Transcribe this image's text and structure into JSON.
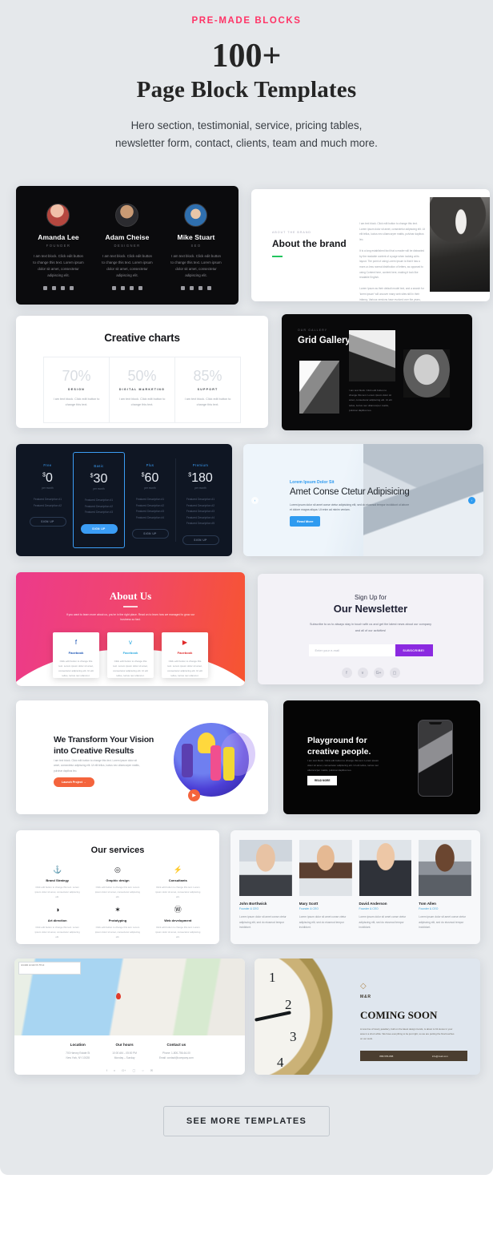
{
  "header": {
    "eyebrow": "PRE-MADE BLOCKS",
    "title": "100+",
    "subtitle": "Page Block Templates",
    "desc_line1": "Hero section, testimonial, service, pricing tables,",
    "desc_line2": "newsletter form, contact, clients, team and much more."
  },
  "cta": {
    "label": "SEE MORE TEMPLATES"
  },
  "colors": {
    "page_bg": "#e5e8eb",
    "accent_pink": "#ff3366",
    "blue": "#3b9df5",
    "purple": "#8b2ae0",
    "orange": "#f4643c",
    "green": "#22c55e"
  },
  "cards": {
    "team_dark": {
      "members": [
        {
          "name": "Amanda Lee",
          "role": "FOUNDER",
          "text": "I am text block. Click edit button to change this text. Lorem ipsum dolor sit amet, consectetur adipiscing elit."
        },
        {
          "name": "Adam Cheise",
          "role": "DESIGNER",
          "text": "I am text block. Click edit button to change this text. Lorem ipsum dolor sit amet, consectetur adipiscing elit."
        },
        {
          "name": "Mike Stuart",
          "role": "SEO",
          "text": "I am text block. Click edit button to change this text. Lorem ipsum dolor sit amet, consectetur adipiscing elit."
        }
      ]
    },
    "about_brand": {
      "kicker": "About the brand",
      "title": "About the brand",
      "paragraphs": [
        "I am text block. Click edit button to change this text. Lorem ipsum dolor sit amet, consectetur adipiscing elit. Ut elit tellus, luctus nec ullamcorper mattis, pulvinar dapibus leo.",
        "It is a long established fact that a reader will be distracted by the readable content of a page when looking at its layout. The point of using Lorem Ipsum is that it has a more-or-less normal distribution of letters, as opposed to using Content here, content here, making it look like readable English.",
        "Lorem Ipsum as their default model text, and a search for 'lorem ipsum' will uncover many web sites still in their infancy. Various versions have evolved over the years, sometimes by accident."
      ]
    },
    "creative_charts": {
      "title": "Creative charts",
      "items": [
        {
          "percent": "70%",
          "label": "DESIGN",
          "text": "I am text block. Click edit button to change this text."
        },
        {
          "percent": "50%",
          "label": "DIGITAL MARKETING",
          "text": "I am text block. Click edit button to change this text."
        },
        {
          "percent": "85%",
          "label": "SUPPORT",
          "text": "I am text block. Click edit button to change this text."
        }
      ]
    },
    "grid_gallery": {
      "kicker": "OUR GALLERY",
      "title": "Grid Gallery Slide",
      "text": "I am text block. Click edit button to change this text. Lorem ipsum dolor sit amet, consectetur adipiscing elit. Ut elit tellus, luctus nec ullamcorper mattis, pulvinar dapibus leo."
    },
    "pricing": {
      "plans": [
        {
          "name": "Free",
          "currency": "$",
          "amount": "0",
          "period": "per month",
          "features": [
            "Featured Description #1",
            "Featured Description #2"
          ],
          "button": "SIGN UP",
          "highlight": false
        },
        {
          "name": "Basic",
          "currency": "$",
          "amount": "30",
          "period": "per month",
          "features": [
            "Featured Description #1",
            "Featured Description #2",
            "Featured Description #3"
          ],
          "button": "SIGN UP",
          "highlight": true
        },
        {
          "name": "Plus",
          "currency": "$",
          "amount": "60",
          "period": "per month",
          "features": [
            "Featured Description #1",
            "Featured Description #2",
            "Featured Description #3",
            "Featured Description #4"
          ],
          "button": "SIGN UP",
          "highlight": false
        },
        {
          "name": "Premium",
          "currency": "$",
          "amount": "180",
          "period": "per month",
          "features": [
            "Featured Description #1",
            "Featured Description #2",
            "Featured Description #3",
            "Featured Description #4",
            "Featured Description #5"
          ],
          "button": "SIGN UP",
          "highlight": false
        }
      ]
    },
    "slider": {
      "kicker": "Lorem Ipsum Dolor Sit",
      "title": "Amet Conse Ctetur Adipisicing",
      "text": "Lorem ipsum dolor sit amet conse ctetur adipisicing elit, sed do eiusmod tempor incididunt ut labore et dolore magna aliqua. Ut enim ad minim veniam.",
      "button": "Read More",
      "prev": "‹",
      "next": "›"
    },
    "about_us": {
      "title": "About Us",
      "text": "If you want to learn more about us, you're in the right place. Read on to learn how we managed to grow our business so fast.",
      "items": [
        {
          "icon": "facebook-icon",
          "glyph": "f",
          "color": "#1b55b5",
          "name": "Facebook",
          "text": "Click edit button to change this text. Lorem ipsum dolor sit amet, consectetur adipiscing elit. Ut elit tellus, luctus nec ullamcor."
        },
        {
          "icon": "twitter-icon",
          "glyph": "ᴠ",
          "color": "#2aa9e0",
          "name": "Facebook",
          "text": "Click edit button to change this text. Lorem ipsum dolor sit amet, consectetur adipiscing elit. Ut elit tellus, luctus nec ullamcor."
        },
        {
          "icon": "youtube-icon",
          "glyph": "▶",
          "color": "#e02a2a",
          "name": "Facebook",
          "text": "Click edit button to change this text. Lorem ipsum dolor sit amet, consectetur adipiscing elit. Ut elit tellus, luctus nec ullamcor."
        }
      ]
    },
    "newsletter": {
      "kicker": "Sign Up for",
      "title": "Our Newsletter",
      "text": "Subscribe to us to always stay in touch with us and get the latest news about our company and all of our activities!",
      "placeholder": "Enter your e-mail",
      "button": "SUBSCRIBE!",
      "socials": [
        "f",
        "ᴠ",
        "G+",
        "▢"
      ]
    },
    "transform": {
      "title": "We Transform Your Vision into Creative Results",
      "text": "I am text block. Click edit button to change this text. Lorem ipsum dolor sit amet, consectetur adipiscing elit. Ut elit tellus, luctus nec ullamcorper mattis, pulvinar dapibus leo.",
      "button": "Launch Project →",
      "play": "▶"
    },
    "playground": {
      "title": "Playground for creative people.",
      "text": "I am text block. Click edit button to change this text. Lorem ipsum dolor sit amet, consectetur adipiscing elit. Ut elit tellus, luctus nec ullamcorper mattis, pulvinar dapibus leo.",
      "button": "READ MORE"
    },
    "services": {
      "title": "Our services",
      "items": [
        {
          "icon": "anchor-icon",
          "glyph": "⚓",
          "name": "Brand Strategy",
          "text": "Click edit button to change this text. Lorem ipsum dolor sit amet, consectetur adipiscing elit."
        },
        {
          "icon": "target-icon",
          "glyph": "◎",
          "name": "Graphic design",
          "text": "Click edit button to change this text. Lorem ipsum dolor sit amet, consectetur adipiscing elit."
        },
        {
          "icon": "bolt-icon",
          "glyph": "⚡",
          "name": "Consultants",
          "text": "Click edit button to change this text. Lorem ipsum dolor sit amet, consectetur adipiscing elit."
        },
        {
          "icon": "contrast-icon",
          "glyph": "◑",
          "name": "Art direction",
          "text": "Click edit button to change this text. Lorem ipsum dolor sit amet, consectetur adipiscing elit."
        },
        {
          "icon": "asterisk-icon",
          "glyph": "✶",
          "name": "Prototyping",
          "text": "Click edit button to change this text. Lorem ipsum dolor sit amet, consectetur adipiscing elit."
        },
        {
          "icon": "globe-icon",
          "glyph": "Ⓦ",
          "name": "Web development",
          "text": "Click edit button to change this text. Lorem ipsum dolor sit amet, consectetur adipiscing elit."
        }
      ]
    },
    "team_photos": {
      "members": [
        {
          "name": "John Borthwick",
          "role": "Founder & CEO",
          "text": "Lorem ipsum dolor sit amet conse ctetur adipiscing elit, sed do eiusmod tempor incididunt."
        },
        {
          "name": "Mary Scott",
          "role": "Founder & CEO",
          "text": "Lorem ipsum dolor sit amet conse ctetur adipiscing elit, sed do eiusmod tempor incididunt."
        },
        {
          "name": "David Anderson",
          "role": "Founder & CEO",
          "text": "Lorem ipsum dolor sit amet conse ctetur adipiscing elit, sed do eiusmod tempor incididunt."
        },
        {
          "name": "Tom Allen",
          "role": "Founder & CEO",
          "text": "Lorem ipsum dolor sit amet conse ctetur adipiscing elit, sed do eiusmod tempor incididunt."
        }
      ]
    },
    "map_contact": {
      "tooltip": "ramdatki osmdal UK-70b sk",
      "columns": [
        {
          "heading": "Location",
          "line1": "700 Harvey Estate St",
          "line2": "New York, NY 10028"
        },
        {
          "heading": "Our hours",
          "line1": "10:00 AM – 05:00 PM",
          "line2": "Monday – Sunday"
        },
        {
          "heading": "Contact us",
          "line1": "Phone: 1-800-756-64-00",
          "line2": "Email: contact@company.com"
        }
      ],
      "socials": [
        "f",
        "ᴠ",
        "G+",
        "▢",
        "○",
        "✉"
      ]
    },
    "coming_soon": {
      "logo_icon": "diamond-icon",
      "logo_glyph": "◇",
      "brand": "M&R",
      "title": "COMING SOON",
      "text": "A new line of luxury jewellery, built on the latest design trends, is about to hit stores in your area in a short while. We have everything to be just right, so we are putting the final touches on our work.",
      "phone": "888-555-888",
      "email": "info@mail.com",
      "clock_numbers": [
        "1",
        "2",
        "3",
        "4"
      ]
    }
  }
}
